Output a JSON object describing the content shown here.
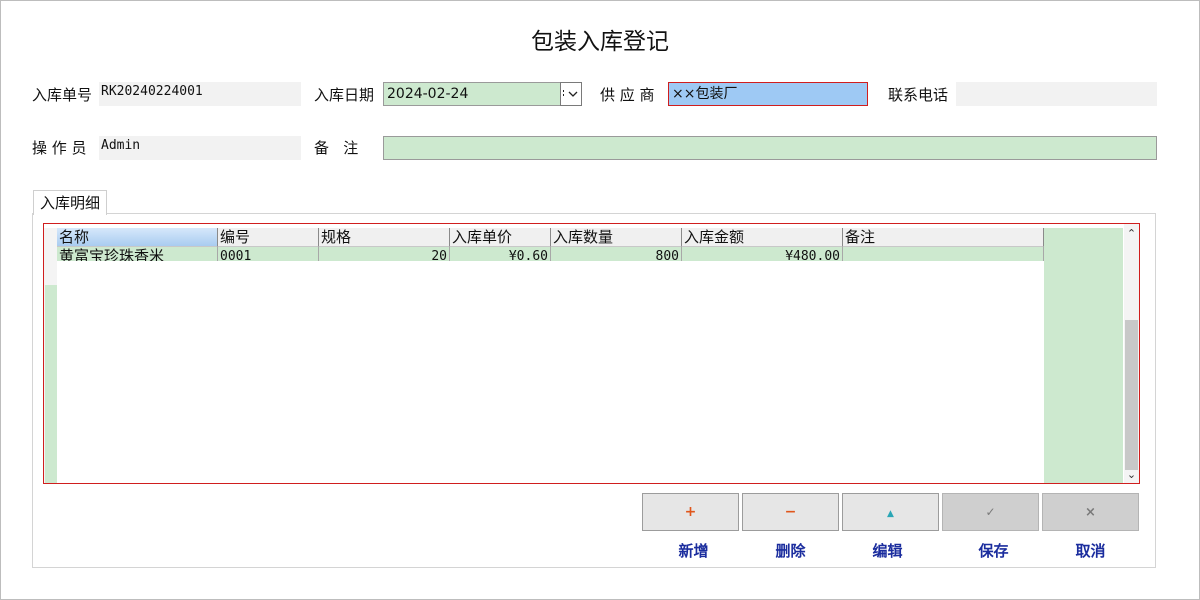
{
  "window": {
    "title": "包装入库登记"
  },
  "form": {
    "order_no": {
      "label": "入库单号",
      "value": "RK20240224001"
    },
    "date": {
      "label": "入库日期",
      "value": "2024-02-24"
    },
    "supplier": {
      "label": "供 应 商",
      "value": "××包装厂"
    },
    "phone": {
      "label": "联系电话",
      "value": ""
    },
    "operator": {
      "label": "操 作 员",
      "value": "Admin"
    },
    "remark": {
      "label": "备   注",
      "value": ""
    }
  },
  "tabs": [
    {
      "label": "入库明细"
    }
  ],
  "grid": {
    "columns": [
      "名称",
      "编号",
      "规格",
      "入库单价",
      "入库数量",
      "入库金额",
      "备注"
    ],
    "rows": [
      {
        "name": "黄富宝珍珠香米",
        "code": "0001",
        "spec": "20",
        "price": "¥0.60",
        "qty": "800",
        "amount": "¥480.00",
        "remark": ""
      }
    ]
  },
  "buttons": [
    {
      "id": "add",
      "icon": "plus-icon",
      "glyph": "+",
      "label": "新增",
      "color": "#e0561b",
      "enabled": true
    },
    {
      "id": "delete",
      "icon": "minus-icon",
      "glyph": "−",
      "label": "删除",
      "color": "#e0561b",
      "enabled": true
    },
    {
      "id": "edit",
      "icon": "triangle-up-icon",
      "glyph": "▲",
      "label": "编辑",
      "color": "#2aa6b5",
      "enabled": true
    },
    {
      "id": "save",
      "icon": "check-icon",
      "glyph": "✓",
      "label": "保存",
      "color": "#7a7a7a",
      "enabled": false
    },
    {
      "id": "cancel",
      "icon": "close-icon",
      "glyph": "×",
      "label": "取消",
      "color": "#7a7a7a",
      "enabled": false
    }
  ],
  "colors": {
    "field_green": "#cde9cf",
    "field_blue": "#9ec9f4",
    "focus_border": "#d01e1e",
    "button_label": "#1b2d9e"
  }
}
